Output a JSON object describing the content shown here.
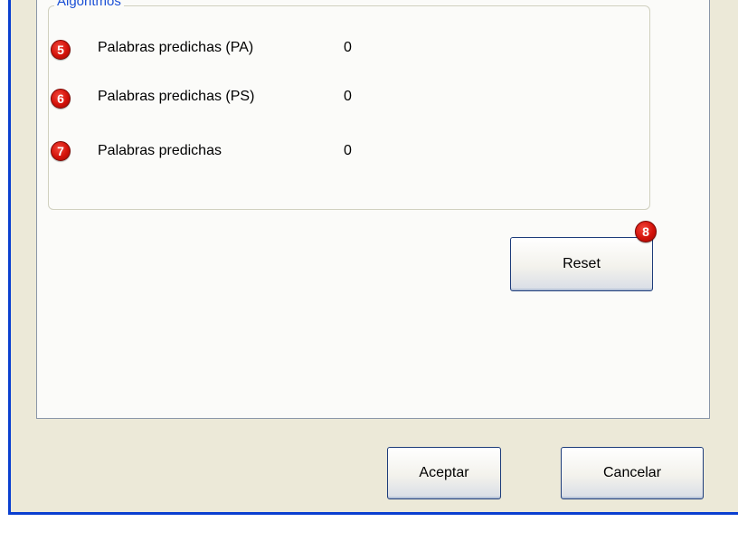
{
  "dialog": {
    "group_title": "Algoritmos",
    "rows": [
      {
        "badge": "5",
        "label": "Palabras predichas (PA)",
        "value": "0"
      },
      {
        "badge": "6",
        "label": "Palabras predichas (PS)",
        "value": "0"
      },
      {
        "badge": "7",
        "label": "Palabras predichas",
        "value": "0"
      }
    ],
    "reset_badge": "8",
    "reset_label": "Reset",
    "accept_label": "Aceptar",
    "cancel_label": "Cancelar"
  },
  "colors": {
    "window_border": "#0a3fd0",
    "group_title": "#1a4fd6",
    "badge_red": "#d3120a",
    "dialog_bg": "#ece9d8"
  }
}
